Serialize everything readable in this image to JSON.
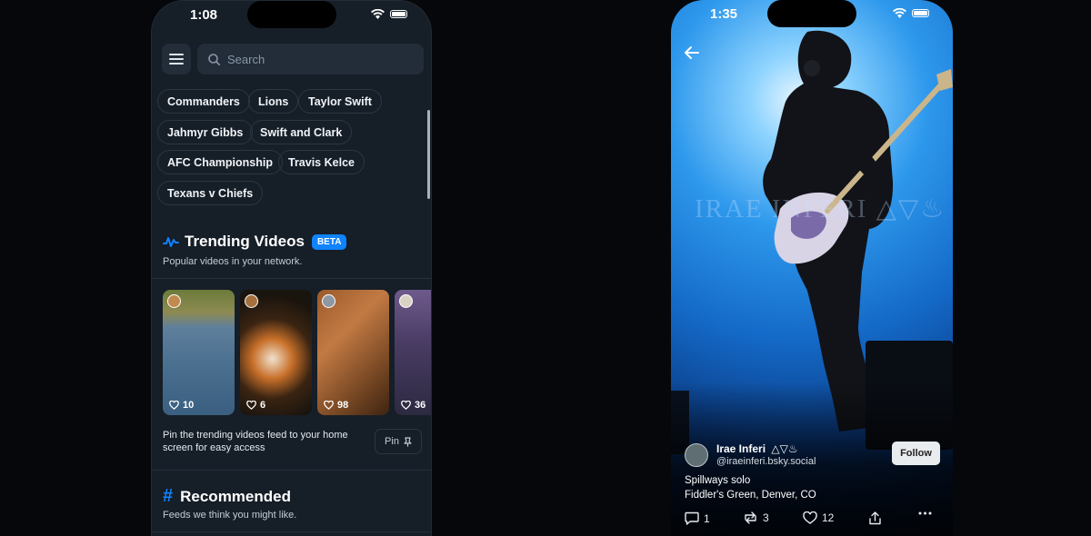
{
  "colors": {
    "accent": "#1083fe",
    "panel_bg": "#161e27",
    "chip_border": "#2c3744"
  },
  "phone1": {
    "status": {
      "time": "1:08"
    },
    "search": {
      "placeholder": "Search"
    },
    "chips": [
      "Commanders",
      "Lions",
      "Taylor Swift",
      "Jahmyr Gibbs",
      "Swift and Clark",
      "AFC Championship",
      "Travis Kelce",
      "Texans v Chiefs"
    ],
    "trending": {
      "title": "Trending Videos",
      "badge": "BETA",
      "subtitle": "Popular videos in your network.",
      "videos": [
        {
          "likes": "10",
          "icon": "heart-icon"
        },
        {
          "likes": "6",
          "icon": "heart-icon"
        },
        {
          "likes": "98",
          "icon": "heart-icon"
        },
        {
          "likes": "36",
          "icon": "heart-icon"
        }
      ],
      "pin_text": "Pin the trending videos feed to your home screen for easy access",
      "pin_label": "Pin"
    },
    "recommended": {
      "title": "Recommended",
      "subtitle": "Feeds we think you might like."
    }
  },
  "phone2": {
    "status": {
      "time": "1:35"
    },
    "watermark": "IRAE INFERI △▽♨",
    "author": {
      "name": "Irae Inferi",
      "glyphs": "△▽♨",
      "handle": "@iraeinferi.bsky.social"
    },
    "follow_label": "Follow",
    "caption_line1": "Spillways solo",
    "caption_line2": "Fiddler's Green, Denver, CO",
    "actions": {
      "replies": "1",
      "reposts": "3",
      "likes": "12"
    }
  }
}
